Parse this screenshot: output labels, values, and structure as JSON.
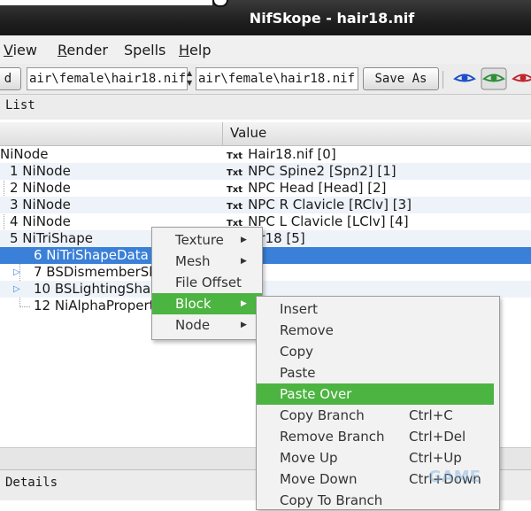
{
  "window": {
    "title": "NifSkope - hair18.nif"
  },
  "menubar": {
    "items": [
      {
        "label": "View",
        "accel": "V",
        "rest": "iew"
      },
      {
        "label": "Render",
        "accel": "R",
        "rest": "ender"
      },
      {
        "label": "Spells",
        "accel": "",
        "rest": "Spells"
      },
      {
        "label": "Help",
        "accel": "H",
        "rest": "elp"
      }
    ]
  },
  "toolbar": {
    "load_label": "d",
    "path_field_1": "air\\female\\hair18.nif",
    "path_field_2": "air\\female\\hair18.nif",
    "save_as_label": "Save As",
    "eye_colors": [
      "#1c4fc9",
      "#2f8f3a",
      "#c0262b"
    ]
  },
  "block_list": {
    "title": "List"
  },
  "tree": {
    "columns": {
      "value": "Value"
    },
    "rows": [
      {
        "name": "NiNode",
        "value": "Hair18.nif [0]"
      },
      {
        "name": "1 NiNode",
        "value": "NPC Spine2 [Spn2] [1]"
      },
      {
        "name": "2 NiNode",
        "value": "NPC Head [Head] [2]"
      },
      {
        "name": "3 NiNode",
        "value": "NPC R Clavicle [RClv] [3]"
      },
      {
        "name": "4 NiNode",
        "value": "NPC L Clavicle [LClv] [4]"
      },
      {
        "name": "5 NiTriShape",
        "value": "air18 [5]"
      },
      {
        "name": "6 NiTriShapeData",
        "value": ""
      },
      {
        "name": "7 BSDismemberSk",
        "value": ""
      },
      {
        "name": "10 BSLightingShad",
        "value": ""
      },
      {
        "name": "12 NiAlphaPropert",
        "value": ""
      }
    ],
    "txt_tag": "Txt"
  },
  "details": {
    "title": "Details"
  },
  "context_menu": {
    "items": [
      {
        "label": "Texture"
      },
      {
        "label": "Mesh"
      },
      {
        "label": "File Offset"
      },
      {
        "label": "Block"
      },
      {
        "label": "Node"
      }
    ]
  },
  "block_submenu": {
    "items": [
      {
        "label": "Insert",
        "shortcut": ""
      },
      {
        "label": "Remove",
        "shortcut": ""
      },
      {
        "label": "Copy",
        "shortcut": ""
      },
      {
        "label": "Paste",
        "shortcut": ""
      },
      {
        "label": "Paste Over",
        "shortcut": ""
      },
      {
        "label": "Copy Branch",
        "shortcut": "Ctrl+C"
      },
      {
        "label": "Remove Branch",
        "shortcut": "Ctrl+Del"
      },
      {
        "label": "Move Up",
        "shortcut": "Ctrl+Up"
      },
      {
        "label": "Move Down",
        "shortcut": "Ctrl+Down"
      },
      {
        "label": "Copy To Branch",
        "shortcut": ""
      }
    ]
  },
  "watermark": "GAME"
}
